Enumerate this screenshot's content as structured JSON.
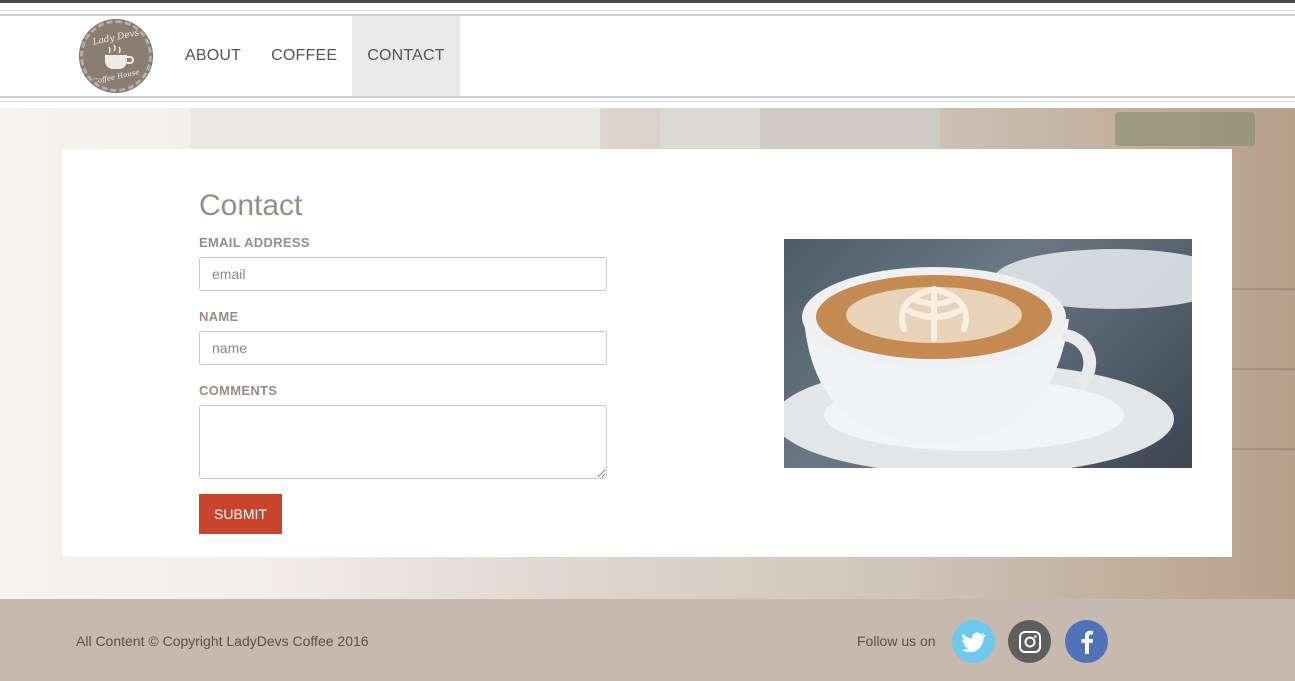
{
  "brand": {
    "logo_top": "Lady Devs",
    "logo_bottom": "Coffee House"
  },
  "nav": {
    "items": [
      {
        "label": "ABOUT"
      },
      {
        "label": "COFFEE"
      },
      {
        "label": "CONTACT",
        "active": true
      }
    ]
  },
  "contact": {
    "title": "Contact",
    "email_label": "EMAIL ADDRESS",
    "email_placeholder": "email",
    "name_label": "NAME",
    "name_placeholder": "name",
    "comments_label": "COMMENTS",
    "comments_value": "",
    "submit_label": "SUBMIT"
  },
  "footer": {
    "copyright": "All Content © Copyright LadyDevs Coffee 2016",
    "follow_label": "Follow us on",
    "social": [
      "twitter-icon",
      "instagram-icon",
      "facebook-icon"
    ]
  },
  "colors": {
    "accent": "#c8442a",
    "heading": "#9d8b7e",
    "footer_bg": "#c7b9ae",
    "twitter": "#6fc8ee",
    "instagram": "#5e5e5e",
    "facebook": "#4f73b8"
  }
}
